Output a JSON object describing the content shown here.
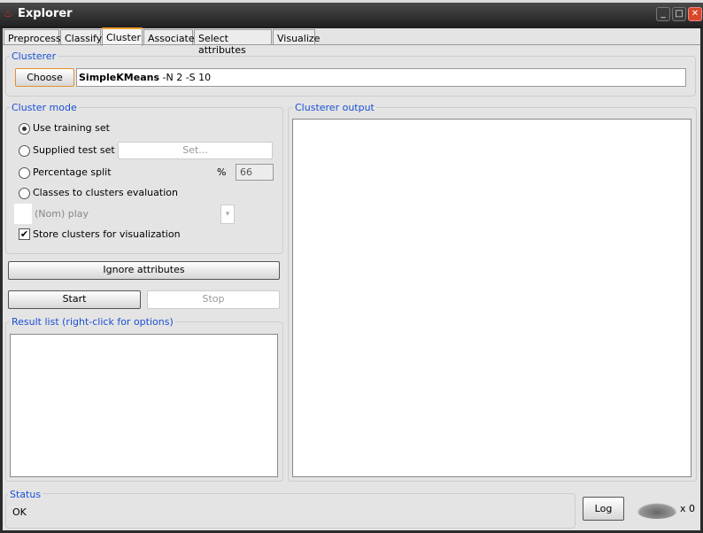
{
  "window": {
    "title": "Explorer"
  },
  "tabs": [
    {
      "label": "Preprocess"
    },
    {
      "label": "Classify"
    },
    {
      "label": "Cluster",
      "active": true
    },
    {
      "label": "Associate"
    },
    {
      "label": "Select attributes"
    },
    {
      "label": "Visualize"
    }
  ],
  "clusterer": {
    "label": "Clusterer",
    "choose": "Choose",
    "algorithm": "SimpleKMeans",
    "options": "-N 2 -S 10"
  },
  "cluster_mode": {
    "label": "Cluster mode",
    "use_training": "Use training set",
    "supplied_test": "Supplied test set",
    "set_button": "Set...",
    "percentage_split": "Percentage split",
    "percent_symbol": "%",
    "percent_value": "66",
    "classes_eval": "Classes to clusters evaluation",
    "class_attribute": "(Nom) play",
    "store_clusters": "Store clusters for visualization",
    "selected": "Use training set",
    "store_checked": true
  },
  "ignore_attributes": "Ignore attributes",
  "start": "Start",
  "stop": "Stop",
  "result_list": {
    "label": "Result list (right-click for options)"
  },
  "output": {
    "label": "Clusterer output"
  },
  "status": {
    "label": "Status",
    "text": "OK"
  },
  "log": "Log",
  "worker_count": "x 0"
}
